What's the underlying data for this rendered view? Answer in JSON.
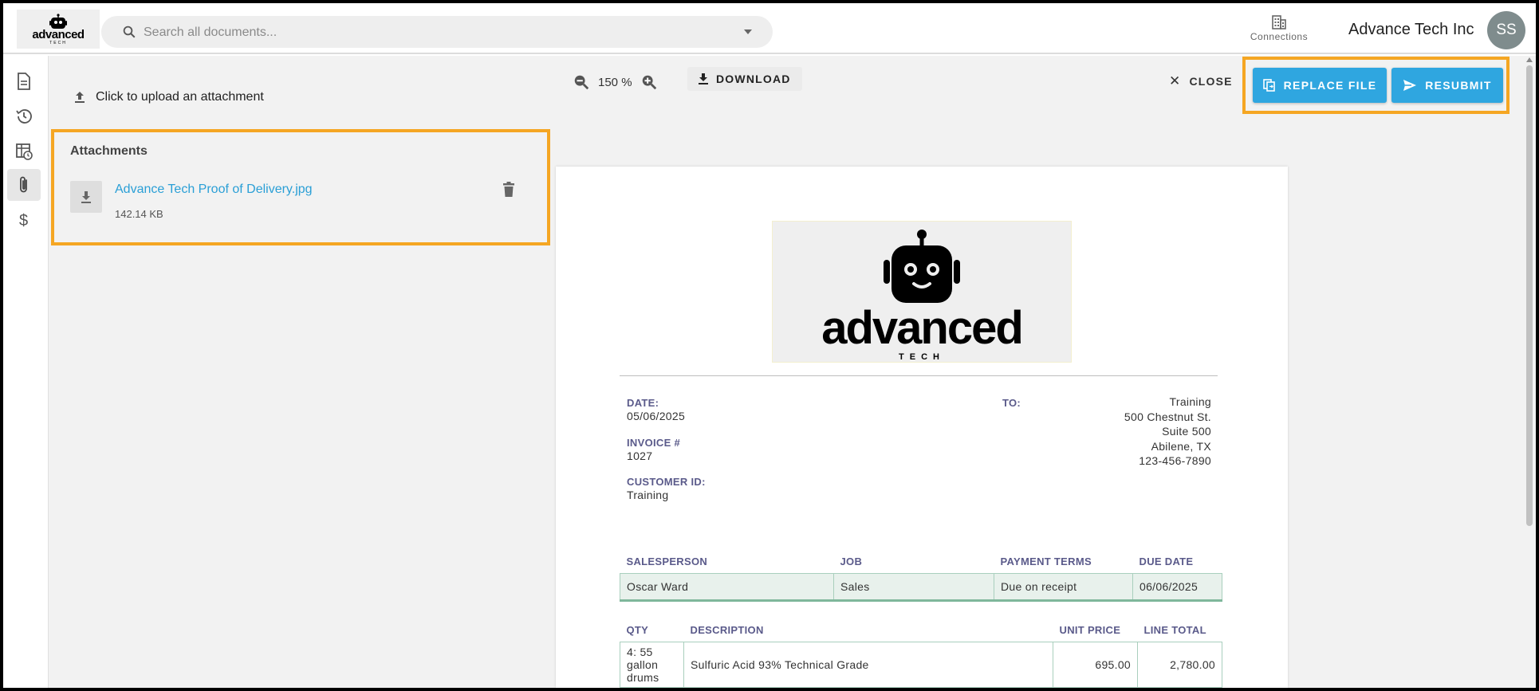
{
  "header": {
    "logo_text": "advanced",
    "logo_sub": "TECH",
    "search_placeholder": "Search all documents...",
    "connections_label": "Connections",
    "company_name": "Advance Tech Inc",
    "avatar_initials": "SS"
  },
  "sidebar": {
    "items": [
      {
        "icon": "document-icon"
      },
      {
        "icon": "history-icon"
      },
      {
        "icon": "table-clock-icon"
      },
      {
        "icon": "paperclip-icon",
        "active": true
      },
      {
        "icon": "dollar-icon"
      }
    ]
  },
  "upload": {
    "label": "Click to upload an attachment"
  },
  "attachments": {
    "title": "Attachments",
    "files": [
      {
        "name": "Advance Tech Proof of Delivery.jpg",
        "size": "142.14 KB"
      }
    ]
  },
  "viewer": {
    "zoom": "150 %",
    "download_label": "DOWNLOAD",
    "close_label": "CLOSE",
    "replace_label": "REPLACE FILE",
    "resubmit_label": "RESUBMIT"
  },
  "invoice": {
    "logo_word": "advanced",
    "logo_tech": "TECH",
    "date_label": "DATE:",
    "date": "05/06/2025",
    "invoice_label": "INVOICE #",
    "invoice_no": "1027",
    "customer_label": "CUSTOMER ID:",
    "customer_id": "Training",
    "to_label": "TO:",
    "to_lines": [
      "Training",
      "500 Chestnut St.",
      "Suite 500",
      "Abilene, TX",
      "123-456-7890"
    ],
    "sales_headers": [
      "SALESPERSON",
      "JOB",
      "PAYMENT TERMS",
      "DUE DATE"
    ],
    "sales_row": [
      "Oscar Ward",
      "Sales",
      "Due on receipt",
      "06/06/2025"
    ],
    "item_headers": [
      "QTY",
      "DESCRIPTION",
      "UNIT PRICE",
      "LINE TOTAL"
    ],
    "items": [
      {
        "qty": "4: 55 gallon drums",
        "description": "Sulfuric Acid 93% Technical Grade",
        "unit_price": "695.00",
        "line_total": "2,780.00"
      }
    ]
  },
  "colors": {
    "accent": "#2fa6e0",
    "highlight": "#f5a623",
    "link": "#2a9fd6"
  }
}
